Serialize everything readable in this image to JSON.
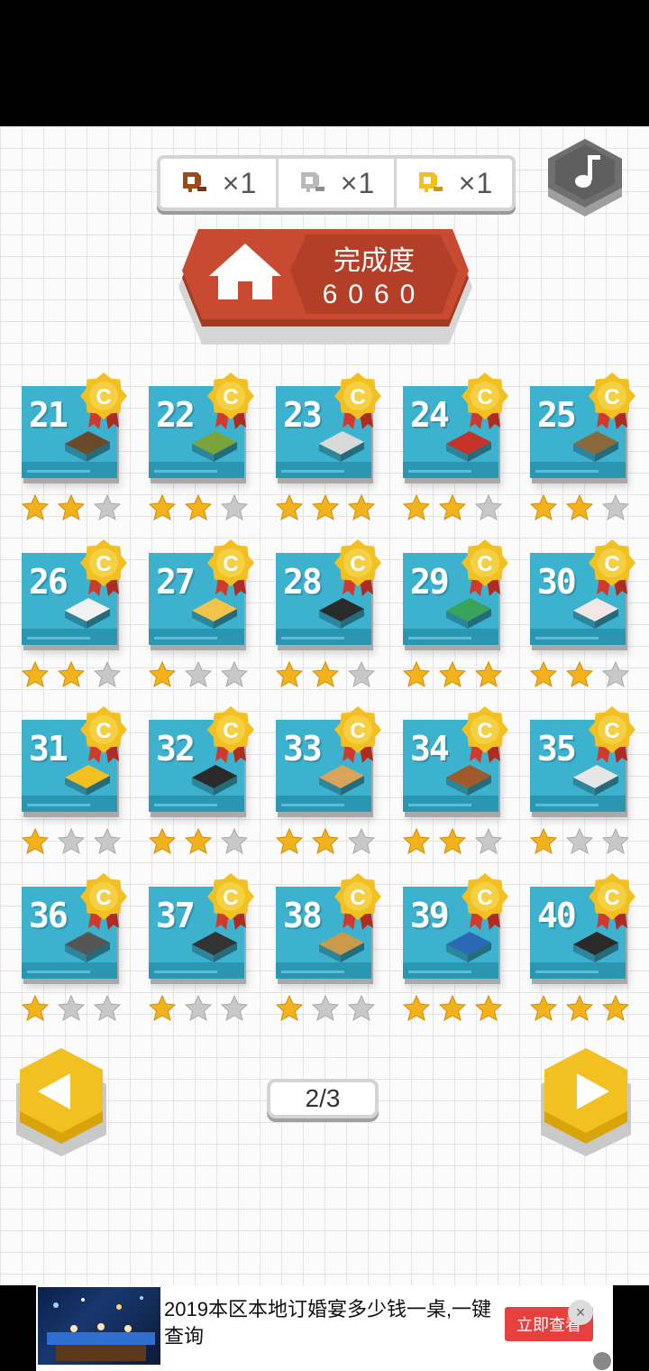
{
  "keys": [
    {
      "type": "bronze",
      "count": "×1",
      "color": "#9b4a1a",
      "icon": "bronze-key-icon"
    },
    {
      "type": "silver",
      "count": "×1",
      "color": "#b9b9b9",
      "icon": "silver-key-icon"
    },
    {
      "type": "gold",
      "count": "×1",
      "color": "#f2c021",
      "icon": "gold-key-icon"
    }
  ],
  "music_icon": "music-note-icon",
  "home": {
    "icon": "home-icon",
    "completion_label": "完成度",
    "completion_value": "6060"
  },
  "levels": [
    {
      "number": "21",
      "stars": 2
    },
    {
      "number": "22",
      "stars": 2
    },
    {
      "number": "23",
      "stars": 3
    },
    {
      "number": "24",
      "stars": 2
    },
    {
      "number": "25",
      "stars": 2
    },
    {
      "number": "26",
      "stars": 2
    },
    {
      "number": "27",
      "stars": 1
    },
    {
      "number": "28",
      "stars": 2
    },
    {
      "number": "29",
      "stars": 3
    },
    {
      "number": "30",
      "stars": 2
    },
    {
      "number": "31",
      "stars": 1
    },
    {
      "number": "32",
      "stars": 2
    },
    {
      "number": "33",
      "stars": 2
    },
    {
      "number": "34",
      "stars": 2
    },
    {
      "number": "35",
      "stars": 1
    },
    {
      "number": "36",
      "stars": 1
    },
    {
      "number": "37",
      "stars": 1
    },
    {
      "number": "38",
      "stars": 1
    },
    {
      "number": "39",
      "stars": 3
    },
    {
      "number": "40",
      "stars": 3
    }
  ],
  "badge_letter": "C",
  "pagination": {
    "page": "2/3",
    "prev_icon": "arrow-left-icon",
    "next_icon": "arrow-right-icon"
  },
  "ad": {
    "text": "2019本区本地订婚宴多少钱一桌,一键查询",
    "cta": "立即查看",
    "close": "×"
  },
  "colors": {
    "accent_red": "#c84a30",
    "gold": "#f2c021",
    "thumb_blue": "#3cb2cf"
  }
}
